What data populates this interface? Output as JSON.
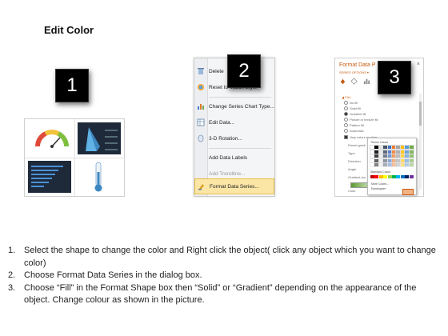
{
  "title": "Edit Color",
  "badges": [
    "1",
    "2",
    "3"
  ],
  "menu": {
    "items": [
      {
        "label": "Delete",
        "icon": "delete-icon",
        "enabled": true
      },
      {
        "label": "Reset to Match Style",
        "icon": "reset-style-icon",
        "enabled": true
      },
      {
        "label": "Change Series Chart Type...",
        "icon": "chart-type-icon",
        "enabled": true
      },
      {
        "label": "Edit Data...",
        "icon": "edit-data-icon",
        "enabled": true
      },
      {
        "label": "3-D Rotation...",
        "icon": "rotation-icon",
        "enabled": true
      },
      {
        "label": "Add Data Labels",
        "icon": "",
        "enabled": true
      },
      {
        "label": "Add Trendline...",
        "icon": "",
        "enabled": false
      },
      {
        "label": "Format Data Series...",
        "icon": "format-series-icon",
        "enabled": true,
        "selected": true
      }
    ]
  },
  "pane": {
    "title": "Format Data P",
    "close": "×",
    "subtitle": "SERIES OPTIONS ▾",
    "section": "◢ FILL",
    "fill_options": [
      {
        "label": "No fill",
        "checked": false
      },
      {
        "label": "Solid fill",
        "checked": false
      },
      {
        "label": "Gradient fill",
        "checked": true
      },
      {
        "label": "Picture or texture fill",
        "checked": false
      },
      {
        "label": "Pattern fill",
        "checked": false
      },
      {
        "label": "Automatic",
        "checked": false
      }
    ],
    "vary_colors": "Vary colors by slice",
    "rows": [
      "Preset gradi",
      "Type",
      "Direction",
      "Angle",
      "Gradient sto",
      "Color"
    ],
    "palette": {
      "theme_title": "Theme Colors",
      "standard_title": "Standard Colors",
      "more_colors": "More Colors...",
      "eyedropper": "Eyedropper"
    }
  },
  "instructions": [
    {
      "num": "1.",
      "text": "Select the shape to change the color and Right click the object( click any object which you want to change color)"
    },
    {
      "num": "2.",
      "text": "Choose Format Data Series in the dialog box."
    },
    {
      "num": "3.",
      "text": "Choose “Fill” in the Format Shape box then “Solid” or “Gradient” depending on the appearance of the object. Change colour as shown in the picture."
    }
  ],
  "colors": {
    "badge_bg": "#000000",
    "menu_highlight": "#fbe6a6",
    "pane_accent": "#c55a11"
  }
}
